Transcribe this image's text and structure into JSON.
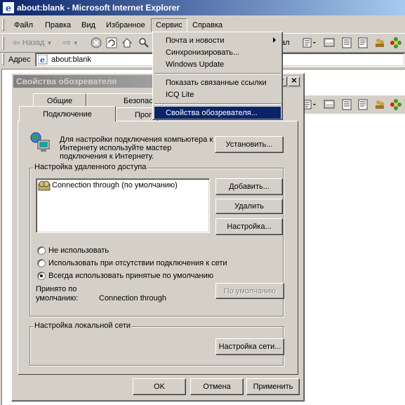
{
  "window": {
    "title": "about:blank - Microsoft Internet Explorer"
  },
  "menubar": {
    "items": [
      "Файл",
      "Правка",
      "Вид",
      "Избранное",
      "Сервис",
      "Справка"
    ]
  },
  "toolbar": {
    "back_label": "Назад",
    "trailing_text": "ал"
  },
  "address": {
    "label": "Адрес",
    "value": "about:blank"
  },
  "service_menu": {
    "items": [
      "Почта и новости",
      "Синхронизировать...",
      "Windows Update",
      "Показать связанные ссылки",
      "ICQ Lite",
      "Свойства обозревателя..."
    ],
    "selected": "Свойства обозревателя..."
  },
  "dialog": {
    "title": "Свойства обозревателя",
    "tabs_top": [
      "Общие",
      "Безопас"
    ],
    "tabs_bottom": [
      "Подключение",
      "Прог"
    ],
    "active_tab": "Подключение",
    "setup_text": "Для настройки подключения компьютера к Интернету используйте мастер подключения к Интернету.",
    "setup_button": "Установить...",
    "dialup_group": "Настройка удаленного доступа",
    "connections": [
      "Connection through (по умолчанию)"
    ],
    "add_button": "Добавить...",
    "remove_button": "Удалить",
    "settings_button": "Настройка...",
    "radios": [
      "Не использовать",
      "Использовать при отсутствии подключения к сети",
      "Всегда использовать принятые по умолчанию"
    ],
    "selected_radio": "Всегда использовать принятые по умолчанию",
    "default_label": "Принято по умолчанию:",
    "default_value": "Connection through",
    "default_button": "По умолчанию",
    "lan_group": "Настройка локальной сети",
    "lan_button": "Настройка сети...",
    "ok_button": "OK",
    "cancel_button": "Отмена",
    "apply_button": "Применить"
  },
  "colors": {
    "title_active": "#0a246a",
    "face": "#d4d0c8",
    "selection": "#0a246a"
  }
}
